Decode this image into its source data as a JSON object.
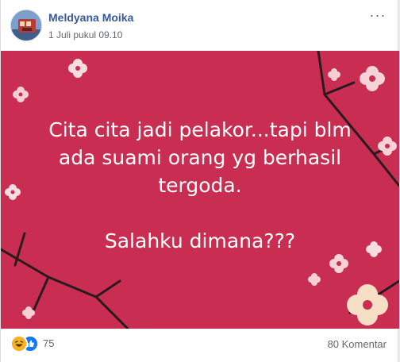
{
  "post": {
    "author": "Meldyana Moika",
    "timestamp": "1 Juli pukul 09.10",
    "more_label": "···",
    "image": {
      "background_color": "#c92e52",
      "quote_lines": [
        "Cita cita jadi pelakor...tapi blm",
        "ada suami orang yg berhasil",
        "tergoda.",
        "",
        "Salahku dimana???"
      ]
    },
    "reactions": {
      "icons": [
        "haha-icon",
        "like-icon"
      ],
      "count": "75"
    },
    "comments_label": "80 Komentar"
  },
  "colors": {
    "author_link": "#385898",
    "meta_text": "#616770",
    "image_bg": "#c92e52",
    "like_blue": "#1877f2",
    "haha_yellow": "#f7b125"
  }
}
